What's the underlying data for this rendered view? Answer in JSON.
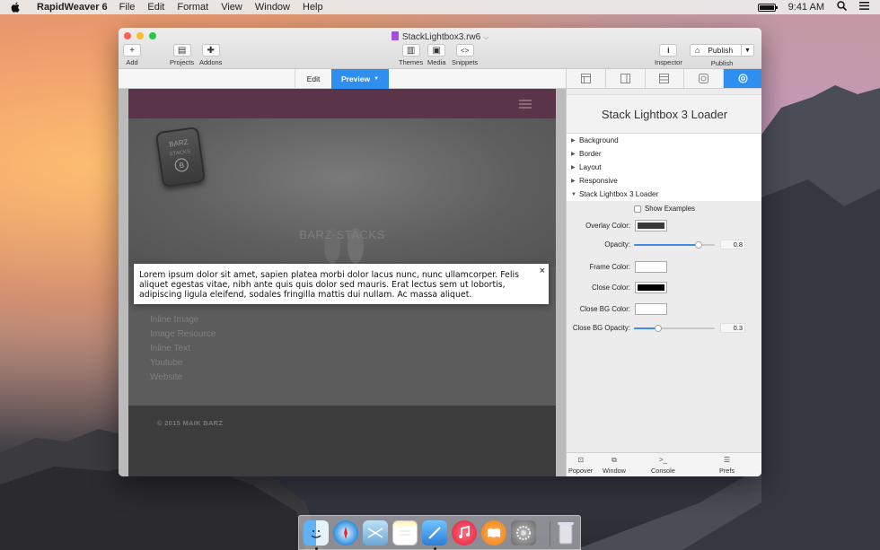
{
  "menubar": {
    "app_name": "RapidWeaver 6",
    "menus": [
      "File",
      "Edit",
      "Format",
      "View",
      "Window",
      "Help"
    ],
    "time": "9:41 AM"
  },
  "window": {
    "doc_title": "StackLightbox3.rw6",
    "toolbar": {
      "add": "Add",
      "projects": "Projects",
      "addons": "Addons",
      "themes": "Themes",
      "media": "Media",
      "snippets": "Snippets",
      "inspector": "Inspector",
      "publish_btn": "Publish",
      "publish_caption": "Publish"
    },
    "modes": {
      "edit": "Edit",
      "preview": "Preview"
    }
  },
  "page": {
    "hero_title": "BARZ-STACKS",
    "links": [
      "Inline Image",
      "Image Resource",
      "Inline Text",
      "Youtube",
      "Website"
    ],
    "footer": "© 2015 MAIK BARZ"
  },
  "lightbox": {
    "text": "Lorem ipsum dolor sit amet, sapien platea morbi dolor lacus nunc, nunc ullamcorper. Felis aliquet egestas vitae, nibh ante quis quis dolor sed mauris. Erat lectus sem ut lobortis, adipiscing ligula eleifend, sodales fringilla mattis dui nullam. Ac massa aliquet.",
    "close": "×"
  },
  "inspector": {
    "title": "Stack Lightbox 3 Loader",
    "sections": [
      "Background",
      "Border",
      "Layout",
      "Responsive",
      "Stack Lightbox 3 Loader"
    ],
    "show_examples": "Show Examples",
    "overlay_color_label": "Overlay Color:",
    "overlay_color": "#3a3a3a",
    "opacity_label": "Opacity:",
    "opacity_value": "0.8",
    "opacity_fraction": 0.8,
    "frame_color_label": "Frame Color:",
    "frame_color": "#ffffff",
    "close_color_label": "Close Color:",
    "close_color": "#000000",
    "close_bg_color_label": "Close BG Color:",
    "close_bg_color": "#ffffff",
    "close_bg_opacity_label": "Close BG Opacity:",
    "close_bg_opacity_value": "0.3",
    "close_bg_opacity_fraction": 0.3,
    "bottom": {
      "popover": "Popover",
      "window": "Window",
      "console": "Console",
      "prefs": "Prefs"
    }
  },
  "colors": {
    "accent": "#2f8ff0",
    "header_bar": "#5a3448"
  }
}
